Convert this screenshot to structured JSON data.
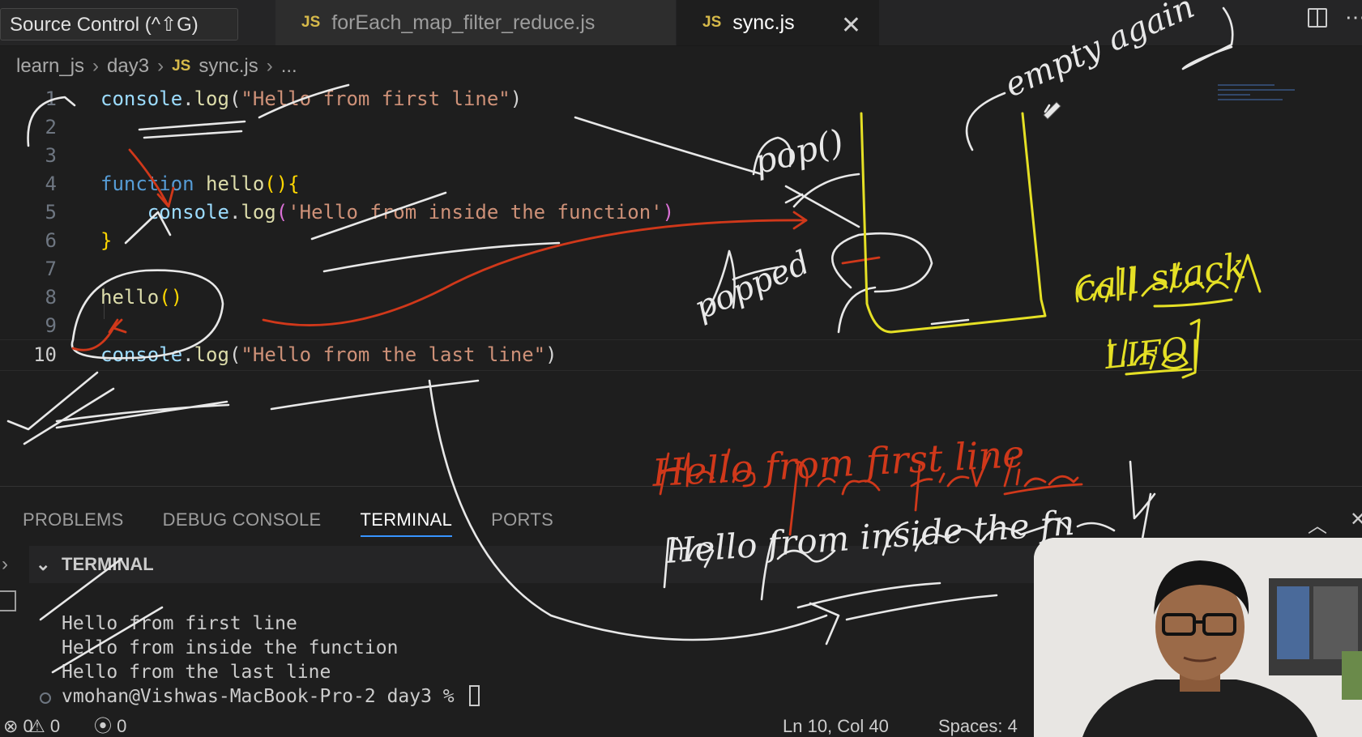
{
  "tabbar": {
    "tooltip": "Source Control (^⇧G)",
    "tabs": [
      {
        "badge": "JS",
        "label": "forEach_map_filter_reduce.js"
      },
      {
        "badge": "JS",
        "label": "sync.js",
        "close": "✕"
      }
    ]
  },
  "breadcrumb": {
    "items": [
      "learn_js",
      "day3",
      "sync.js",
      "..."
    ],
    "separator": "›",
    "file_badge": "JS"
  },
  "editor": {
    "lines": [
      {
        "n": "1",
        "tokens": [
          [
            "var",
            "console"
          ],
          [
            "p",
            "."
          ],
          [
            "fn",
            "log"
          ],
          [
            "p",
            "("
          ],
          [
            "str",
            "\"Hello from first line\""
          ],
          [
            "p",
            ")"
          ]
        ]
      },
      {
        "n": "2",
        "tokens": []
      },
      {
        "n": "3",
        "tokens": []
      },
      {
        "n": "4",
        "tokens": [
          [
            "kw",
            "function"
          ],
          [
            "p",
            " "
          ],
          [
            "fn",
            "hello"
          ],
          [
            "brace",
            "(){"
          ]
        ]
      },
      {
        "n": "5",
        "tokens": [
          [
            "p",
            "    "
          ],
          [
            "var",
            "console"
          ],
          [
            "p",
            "."
          ],
          [
            "fn",
            "log"
          ],
          [
            "paren2",
            "("
          ],
          [
            "str",
            "'Hello from inside the function'"
          ],
          [
            "paren2",
            ")"
          ]
        ]
      },
      {
        "n": "6",
        "tokens": [
          [
            "brace",
            "}"
          ]
        ]
      },
      {
        "n": "7",
        "tokens": []
      },
      {
        "n": "8",
        "tokens": [
          [
            "fn",
            "hello"
          ],
          [
            "brace",
            "()"
          ]
        ]
      },
      {
        "n": "9",
        "tokens": []
      },
      {
        "n": "10",
        "tokens": [
          [
            "var",
            "console"
          ],
          [
            "p",
            "."
          ],
          [
            "fn",
            "log"
          ],
          [
            "p",
            "("
          ],
          [
            "str",
            "\"Hello from the last line\""
          ],
          [
            "p",
            ")"
          ]
        ]
      }
    ],
    "current_line": "10"
  },
  "panel": {
    "tabs": [
      "PROBLEMS",
      "DEBUG CONSOLE",
      "TERMINAL",
      "PORTS"
    ],
    "active_tab": "TERMINAL",
    "terminal_title": "TERMINAL",
    "output": [
      "Hello from first line",
      "Hello from inside the function",
      "Hello from the last line"
    ],
    "prompt": "vmohan@Vishwas-MacBook-Pro-2 day3 % "
  },
  "statusbar": {
    "errors": "0",
    "warnings": "0",
    "ports": "0",
    "position": "Ln 10, Col 40",
    "spaces": "Spaces: 4"
  },
  "annotations": {
    "pop": "pop()",
    "popped": "popped",
    "empty_again": "empty again",
    "call_stack": "call stack",
    "lifo": "LIFO",
    "output_red": "Hello from first line",
    "output_white": "Hello from inside the fn"
  },
  "colors": {
    "ink_white": "#e8e8e8",
    "ink_red": "#d0381a",
    "ink_yellow": "#e5e025",
    "terminal_tab_accent": "#3794ff"
  }
}
